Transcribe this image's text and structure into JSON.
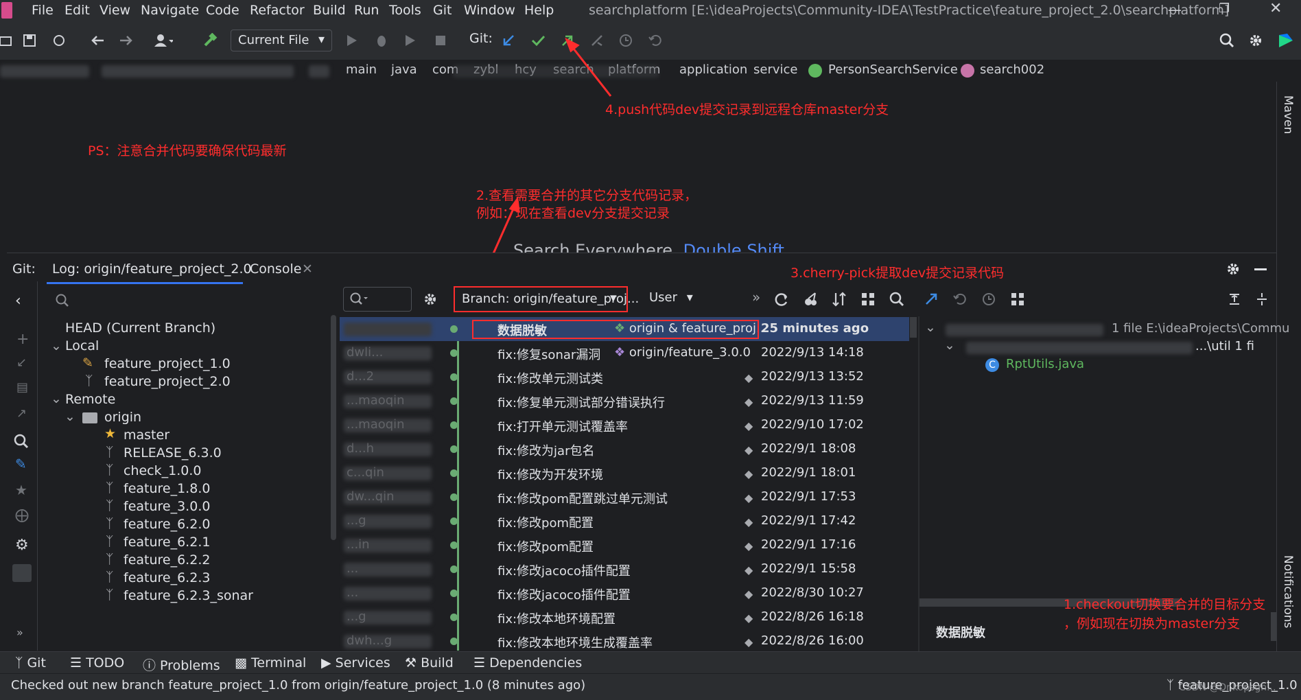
{
  "menu": [
    "File",
    "Edit",
    "View",
    "Navigate",
    "Code",
    "Refactor",
    "Build",
    "Run",
    "Tools",
    "Git",
    "Window",
    "Help"
  ],
  "window_title": "searchplatform [E:\\ideaProjects\\Community-IDEA\\TestPractice\\feature_project_2.0\\searchplatform]",
  "toolbar": {
    "run_config": "Current File",
    "git_label": "Git:"
  },
  "breadcrumb": [
    "main",
    "java",
    "com",
    "zybl",
    "hcy",
    "search",
    "platform",
    "application",
    "service",
    "PersonSearchService",
    "search002"
  ],
  "annotations": {
    "push": "4.push代码dev提交记录到远程仓库master分支",
    "ps": "PS：注意合并代码要确保代码最新",
    "view_line1": "2.查看需要合并的其它分支代码记录，",
    "view_line2": "例如：现在查看dev分支提交记录",
    "cherry": "3.cherry-pick提取dev提交记录代码",
    "checkout_line1": "1.checkout切换要合并的目标分支",
    "checkout_line2": "，例如现在切换为master分支"
  },
  "search_hint": {
    "text": "Search Everywhere",
    "shortcut": "Double Shift"
  },
  "git_panel": {
    "prefix": "Git:",
    "tabs": [
      "Log: origin/feature_project_2.0",
      "Console"
    ],
    "branch_filter": "Branch: origin/feature_proj...",
    "user_filter": "User"
  },
  "branch_tree": {
    "head": "HEAD (Current Branch)",
    "local_label": "Local",
    "local": [
      "feature_project_1.0",
      "feature_project_2.0"
    ],
    "remote_label": "Remote",
    "origin_label": "origin",
    "remote_branches": [
      "master",
      "RELEASE_6.3.0",
      "check_1.0.0",
      "feature_1.8.0",
      "feature_3.0.0",
      "feature_6.2.0",
      "feature_6.2.1",
      "feature_6.2.2",
      "feature_6.2.3",
      "feature_6.2.3_sonar"
    ]
  },
  "commits": [
    {
      "author": "",
      "message": "数据脱敏",
      "ref": "origin & feature_proj...",
      "date": "25 minutes ago"
    },
    {
      "author": "dwli...",
      "message": "fix:修复sonar漏洞",
      "ref": "origin/feature_3.0.0",
      "date": "2022/9/13 14:18"
    },
    {
      "author": "d...2",
      "message": "fix:修改单元测试类",
      "ref": "",
      "date": "2022/9/13 13:52"
    },
    {
      "author": "...maoqin",
      "message": "fix:修复单元测试部分错误执行",
      "ref": "",
      "date": "2022/9/13 11:59"
    },
    {
      "author": "...maoqin",
      "message": "fix:打开单元测试覆盖率",
      "ref": "",
      "date": "2022/9/10 17:02"
    },
    {
      "author": "d...h",
      "message": "fix:修改为jar包名",
      "ref": "",
      "date": "2022/9/1 18:08"
    },
    {
      "author": "c...qin",
      "message": "fix:修改为开发环境",
      "ref": "",
      "date": "2022/9/1 18:01"
    },
    {
      "author": "dw...qin",
      "message": "fix:修改pom配置跳过单元测试",
      "ref": "",
      "date": "2022/9/1 17:53"
    },
    {
      "author": "...g",
      "message": "fix:修改pom配置",
      "ref": "",
      "date": "2022/9/1 17:42"
    },
    {
      "author": "...in",
      "message": "fix:修改pom配置",
      "ref": "",
      "date": "2022/9/1 17:16"
    },
    {
      "author": "...",
      "message": "fix:修改jacoco插件配置",
      "ref": "",
      "date": "2022/9/1 15:58"
    },
    {
      "author": "...",
      "message": "fix:修改jacoco插件配置",
      "ref": "",
      "date": "2022/8/30 10:27"
    },
    {
      "author": "...g",
      "message": "fix:修改本地环境配置",
      "ref": "",
      "date": "2022/8/26 16:18"
    },
    {
      "author": "dwh...g",
      "message": "fix:修改本地环境生成覆盖率",
      "ref": "",
      "date": "2022/8/26 16:00"
    }
  ],
  "changes": {
    "root_info": "1 file  E:\\ideaProjects\\Commu",
    "dir_info": "...\\util  1 fi",
    "file": "RptUtils.java",
    "commit_message": "数据脱敏"
  },
  "bottom_tabs": [
    "Git",
    "TODO",
    "Problems",
    "Terminal",
    "Services",
    "Build",
    "Dependencies"
  ],
  "status": {
    "message": "Checked out new branch feature_project_1.0 from origin/feature_project_1.0 (8 minutes ago)",
    "branch": "feature_project_1.0",
    "watermark": "CSDN @Dr.kopsgh..."
  },
  "right_tools": [
    "Maven",
    "Notifications"
  ],
  "colors": {
    "bg": "#1e1f22",
    "panel": "#2b2d30",
    "accent": "#3574f0",
    "annotation": "#ff2d2d",
    "graph": "#6aab73"
  }
}
